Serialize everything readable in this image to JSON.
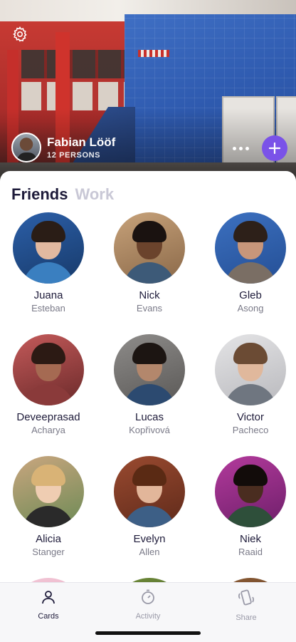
{
  "header": {
    "owner_name": "Fabian Lööf",
    "owner_count": "12 PERSONS",
    "icons": {
      "settings": "gear-icon",
      "more": "more-horizontal-icon",
      "add": "plus-icon"
    }
  },
  "tabs": [
    {
      "label": "Friends",
      "active": true
    },
    {
      "label": "Work",
      "active": false
    }
  ],
  "people": [
    {
      "first": "Juana",
      "last": "Esteban"
    },
    {
      "first": "Nick",
      "last": "Evans"
    },
    {
      "first": "Gleb",
      "last": "Asong"
    },
    {
      "first": "Deveeprasad",
      "last": "Acharya"
    },
    {
      "first": "Lucas",
      "last": "Kopřivová"
    },
    {
      "first": "Victor",
      "last": "Pacheco"
    },
    {
      "first": "Alicia",
      "last": "Stanger"
    },
    {
      "first": "Evelyn",
      "last": "Allen"
    },
    {
      "first": "Niek",
      "last": "Raaid"
    }
  ],
  "tabbar": [
    {
      "label": "Cards",
      "icon": "person-icon",
      "active": true
    },
    {
      "label": "Activity",
      "icon": "stopwatch-icon",
      "active": false
    },
    {
      "label": "Share",
      "icon": "phone-shake-icon",
      "active": false
    }
  ],
  "colors": {
    "accent": "#7a52e8",
    "title": "#1e1b3a",
    "inactive_tab": "#c9c8d6"
  }
}
